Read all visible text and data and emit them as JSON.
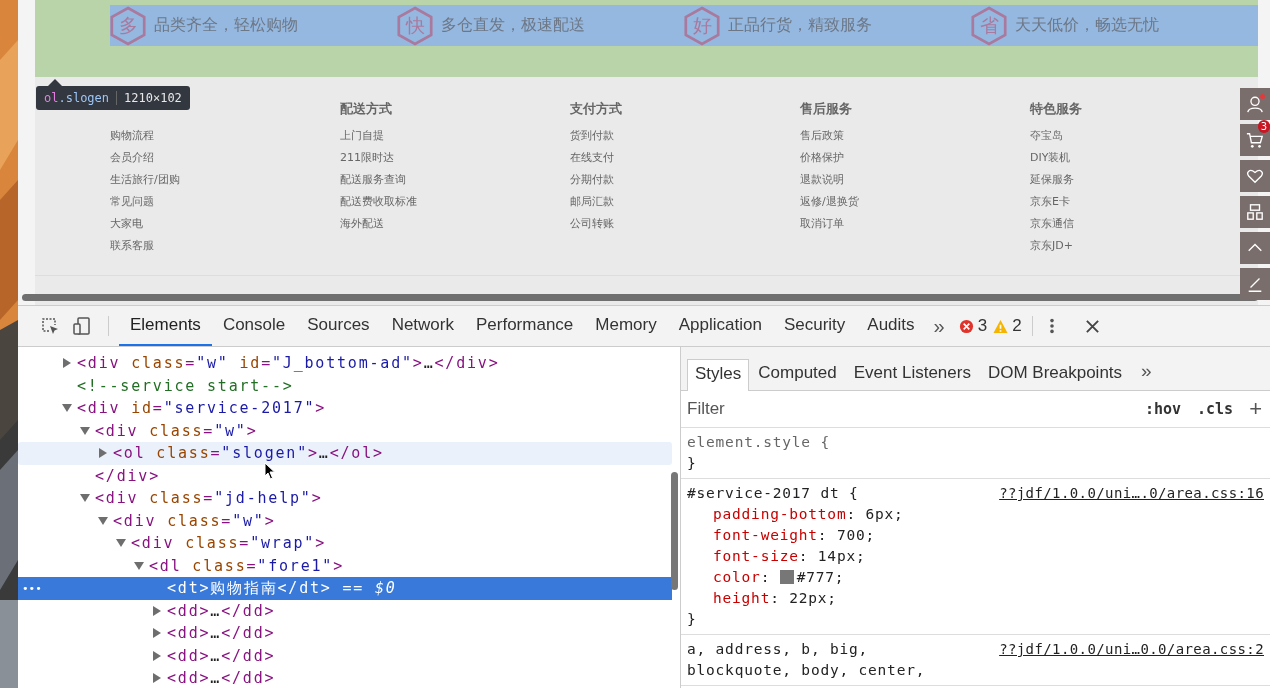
{
  "page": {
    "slogans": [
      {
        "badge": "多",
        "text": "品类齐全，轻松购物"
      },
      {
        "badge": "快",
        "text": "多仓直发，极速配送"
      },
      {
        "badge": "好",
        "text": "正品行货，精致服务"
      },
      {
        "badge": "省",
        "text": "天天低价，畅选无忧"
      }
    ],
    "inspect_tooltip": {
      "tag": "ol",
      "class": ".slogen",
      "size": "1210×102"
    },
    "help_columns": [
      {
        "links": [
          "购物流程",
          "会员介绍",
          "生活旅行/团购",
          "常见问题",
          "大家电",
          "联系客服"
        ]
      },
      {
        "title": "配送方式",
        "links": [
          "上门自提",
          "211限时达",
          "配送服务查询",
          "配送费收取标准",
          "海外配送"
        ]
      },
      {
        "title": "支付方式",
        "links": [
          "货到付款",
          "在线支付",
          "分期付款",
          "邮局汇款",
          "公司转账"
        ]
      },
      {
        "title": "售后服务",
        "links": [
          "售后政策",
          "价格保护",
          "退款说明",
          "返修/退换货",
          "取消订单"
        ]
      },
      {
        "title": "特色服务",
        "links": [
          "夺宝岛",
          "DIY装机",
          "延保服务",
          "京东E卡",
          "京东通信",
          "京东JD+"
        ]
      }
    ],
    "side_tools": [
      {
        "kind": "user",
        "alert": true
      },
      {
        "kind": "cart",
        "alert": false,
        "badge": "3"
      },
      {
        "kind": "heart",
        "alert": false
      },
      {
        "kind": "grid",
        "alert": false
      },
      {
        "kind": "top",
        "alert": false
      },
      {
        "kind": "edit",
        "alert": false
      }
    ]
  },
  "devtools": {
    "tabs": [
      {
        "label": "Elements",
        "selected": true
      },
      {
        "label": "Console",
        "selected": false
      },
      {
        "label": "Sources",
        "selected": false
      },
      {
        "label": "Network",
        "selected": false
      },
      {
        "label": "Performance",
        "selected": false
      },
      {
        "label": "Memory",
        "selected": false
      },
      {
        "label": "Application",
        "selected": false
      },
      {
        "label": "Security",
        "selected": false
      },
      {
        "label": "Audits",
        "selected": false
      }
    ],
    "more": "»",
    "errors": "3",
    "warnings": "2"
  },
  "elements": {
    "nodes": [
      {
        "expanded": false,
        "selected": false,
        "hovered": false,
        "code": [
          {
            "kind": "tag",
            "text": "<div "
          },
          {
            "kind": "attr",
            "text": "class"
          },
          {
            "kind": "tag",
            "text": "="
          },
          {
            "kind": "value",
            "text": "\"w\""
          },
          {
            "kind": "attr",
            "text": " id"
          },
          {
            "kind": "tag",
            "text": "="
          },
          {
            "kind": "value",
            "text": "\"J_bottom-ad\""
          },
          {
            "kind": "tag",
            "text": ">"
          },
          {
            "kind": "text",
            "text": "…"
          },
          {
            "kind": "tag",
            "text": "</div>"
          }
        ]
      },
      {
        "selected": false,
        "hovered": false,
        "code": [
          {
            "kind": "comment",
            "text": "<!--service start-->"
          }
        ]
      },
      {
        "expanded": true,
        "selected": false,
        "hovered": false,
        "code": [
          {
            "kind": "tag",
            "text": "<div "
          },
          {
            "kind": "attr",
            "text": "id"
          },
          {
            "kind": "tag",
            "text": "="
          },
          {
            "kind": "value",
            "text": "\"service-2017\""
          },
          {
            "kind": "tag",
            "text": ">"
          }
        ],
        "children": [
          {
            "expanded": true,
            "selected": false,
            "hovered": false,
            "code": [
              {
                "kind": "tag",
                "text": "<div "
              },
              {
                "kind": "attr",
                "text": "class"
              },
              {
                "kind": "tag",
                "text": "="
              },
              {
                "kind": "value",
                "text": "\"w\""
              },
              {
                "kind": "tag",
                "text": ">"
              }
            ],
            "closing": [
              {
                "kind": "tag",
                "text": "</div>"
              }
            ],
            "children": [
              {
                "expanded": false,
                "selected": false,
                "hovered": true,
                "code": [
                  {
                    "kind": "tag",
                    "text": "<ol "
                  },
                  {
                    "kind": "attr",
                    "text": "class"
                  },
                  {
                    "kind": "tag",
                    "text": "="
                  },
                  {
                    "kind": "value",
                    "text": "\"slogen\""
                  },
                  {
                    "kind": "tag",
                    "text": ">"
                  },
                  {
                    "kind": "text",
                    "text": "…"
                  },
                  {
                    "kind": "tag",
                    "text": "</ol>"
                  }
                ]
              }
            ]
          },
          {
            "expanded": true,
            "selected": false,
            "hovered": false,
            "code": [
              {
                "kind": "tag",
                "text": "<div "
              },
              {
                "kind": "attr",
                "text": "class"
              },
              {
                "kind": "tag",
                "text": "="
              },
              {
                "kind": "value",
                "text": "\"jd-help\""
              },
              {
                "kind": "tag",
                "text": ">"
              }
            ],
            "children": [
              {
                "expanded": true,
                "selected": false,
                "hovered": false,
                "code": [
                  {
                    "kind": "tag",
                    "text": "<div "
                  },
                  {
                    "kind": "attr",
                    "text": "class"
                  },
                  {
                    "kind": "tag",
                    "text": "="
                  },
                  {
                    "kind": "value",
                    "text": "\"w\""
                  },
                  {
                    "kind": "tag",
                    "text": ">"
                  }
                ],
                "children": [
                  {
                    "expanded": true,
                    "selected": false,
                    "hovered": false,
                    "code": [
                      {
                        "kind": "tag",
                        "text": "<div "
                      },
                      {
                        "kind": "attr",
                        "text": "class"
                      },
                      {
                        "kind": "tag",
                        "text": "="
                      },
                      {
                        "kind": "value",
                        "text": "\"wrap\""
                      },
                      {
                        "kind": "tag",
                        "text": ">"
                      }
                    ],
                    "children": [
                      {
                        "expanded": true,
                        "selected": false,
                        "hovered": false,
                        "code": [
                          {
                            "kind": "tag",
                            "text": "<dl "
                          },
                          {
                            "kind": "attr",
                            "text": "class"
                          },
                          {
                            "kind": "tag",
                            "text": "="
                          },
                          {
                            "kind": "value",
                            "text": "\"fore1\""
                          },
                          {
                            "kind": "tag",
                            "text": ">"
                          }
                        ],
                        "children": [
                          {
                            "selected": true,
                            "hovered": false,
                            "gutter": "•••",
                            "code": [
                              {
                                "kind": "tag",
                                "text": "<dt>"
                              },
                              {
                                "kind": "text",
                                "text": "购物指南"
                              },
                              {
                                "kind": "tag",
                                "text": "</dt>"
                              },
                              {
                                "kind": "ref",
                                "text": " == $0"
                              }
                            ]
                          },
                          {
                            "expanded": false,
                            "selected": false,
                            "hovered": false,
                            "code": [
                              {
                                "kind": "tag",
                                "text": "<dd>"
                              },
                              {
                                "kind": "text",
                                "text": "…"
                              },
                              {
                                "kind": "tag",
                                "text": "</dd>"
                              }
                            ]
                          },
                          {
                            "expanded": false,
                            "selected": false,
                            "hovered": false,
                            "code": [
                              {
                                "kind": "tag",
                                "text": "<dd>"
                              },
                              {
                                "kind": "text",
                                "text": "…"
                              },
                              {
                                "kind": "tag",
                                "text": "</dd>"
                              }
                            ]
                          },
                          {
                            "expanded": false,
                            "selected": false,
                            "hovered": false,
                            "code": [
                              {
                                "kind": "tag",
                                "text": "<dd>"
                              },
                              {
                                "kind": "text",
                                "text": "…"
                              },
                              {
                                "kind": "tag",
                                "text": "</dd>"
                              }
                            ]
                          },
                          {
                            "expanded": false,
                            "selected": false,
                            "hovered": false,
                            "code": [
                              {
                                "kind": "tag",
                                "text": "<dd>"
                              },
                              {
                                "kind": "text",
                                "text": "…"
                              },
                              {
                                "kind": "tag",
                                "text": "</dd>"
                              }
                            ]
                          }
                        ]
                      }
                    ]
                  }
                ]
              }
            ]
          }
        ]
      }
    ]
  },
  "styles": {
    "tabs": [
      {
        "label": "Styles",
        "selected": true
      },
      {
        "label": "Computed",
        "selected": false
      },
      {
        "label": "Event Listeners",
        "selected": false
      },
      {
        "label": "DOM Breakpoints",
        "selected": false
      }
    ],
    "more": "»",
    "filter": {
      "placeholder": "Filter"
    },
    "hov": ":hov",
    "cls": ".cls",
    "add": "+",
    "rules": [
      {
        "kind": "inline",
        "selector_lines": [
          "element.style {"
        ],
        "close": "}"
      },
      {
        "kind": "matched",
        "selector_lines": [
          "#service-2017 dt {"
        ],
        "source": "??jdf/1.0.0/uni….0/area.css:16",
        "close": "}",
        "declarations": [
          {
            "name": "padding-bottom",
            "colon": ": ",
            "value": "6px;"
          },
          {
            "name": "font-weight",
            "colon": ": ",
            "value": "700;"
          },
          {
            "name": "font-size",
            "colon": ": ",
            "value": "14px;"
          },
          {
            "name": "color",
            "colon": ": ",
            "value": "#777;",
            "color": "#777777"
          },
          {
            "name": "height",
            "colon": ": ",
            "value": "22px;"
          }
        ]
      },
      {
        "kind": "matched",
        "selector_lines": [
          "a, address, b, big,",
          "blockquote, body, center,"
        ],
        "source": "??jdf/1.0.0/uni…0.0/area.css:2"
      }
    ]
  }
}
